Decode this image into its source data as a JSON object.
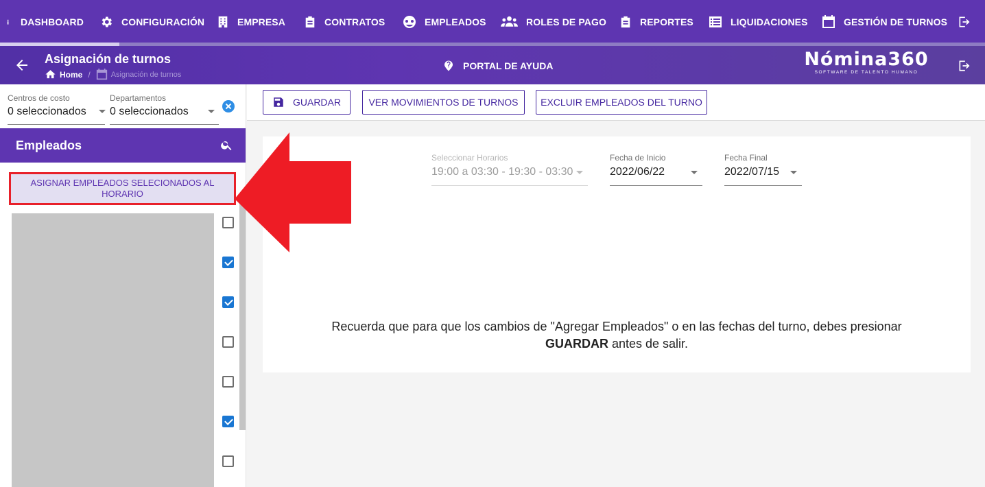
{
  "nav": {
    "items": [
      {
        "label": "DASHBOARD",
        "icon": "info-icon"
      },
      {
        "label": "CONFIGURACIÓN",
        "icon": "gear-icon"
      },
      {
        "label": "EMPRESA",
        "icon": "building-icon"
      },
      {
        "label": "CONTRATOS",
        "icon": "clipboard-icon"
      },
      {
        "label": "EMPLEADOS",
        "icon": "employee-icon"
      },
      {
        "label": "ROLES DE PAGO",
        "icon": "people-icon"
      },
      {
        "label": "REPORTES",
        "icon": "clipboard-icon"
      },
      {
        "label": "LIQUIDACIONES",
        "icon": "list-icon"
      },
      {
        "label": "GESTIÓN DE TURNOS",
        "icon": "calendar-icon"
      }
    ],
    "logout_icon": "logout-icon"
  },
  "header": {
    "title": "Asignación de turnos",
    "breadcrumb": {
      "home": "Home",
      "current": "Asignación de turnos"
    },
    "help_label": "PORTAL DE AYUDA",
    "brand": {
      "name": "Nómina360",
      "tagline": "SOFTWARE DE TALENTO HUMANO"
    }
  },
  "filters": {
    "centros": {
      "label": "Centros de costo",
      "value": "0 seleccionados"
    },
    "departamentos": {
      "label": "Departamentos",
      "value": "0 seleccionados"
    }
  },
  "employees": {
    "title": "Empleados",
    "assign_label": "ASIGNAR EMPLEADOS SELECIONADOS AL HORARIO",
    "checkboxes": [
      false,
      true,
      true,
      false,
      false,
      true,
      false
    ]
  },
  "toolbar": {
    "save_label": "GUARDAR",
    "movements_label": "VER MOVIMIENTOS DE TURNOS",
    "exclude_label": "EXCLUIR EMPLEADOS DEL TURNO"
  },
  "form": {
    "horarios": {
      "label": "Seleccionar Horarios",
      "value": "19:00 a 03:30 - 19:30 - 03:30"
    },
    "fecha_inicio": {
      "label": "Fecha de Inicio",
      "value": "2022/06/22"
    },
    "fecha_final": {
      "label": "Fecha Final",
      "value": "2022/07/15"
    }
  },
  "notice": {
    "text_before": "Recuerda que para que los cambios de \"Agregar Empleados\" o en las fechas del turno, debes presionar",
    "emphasis": "GUARDAR",
    "text_after": "antes de salir."
  },
  "colors": {
    "primary": "#5e35b1",
    "accent": "#4527a0",
    "annotation": "#e8202a",
    "checkbox": "#1976d2"
  }
}
